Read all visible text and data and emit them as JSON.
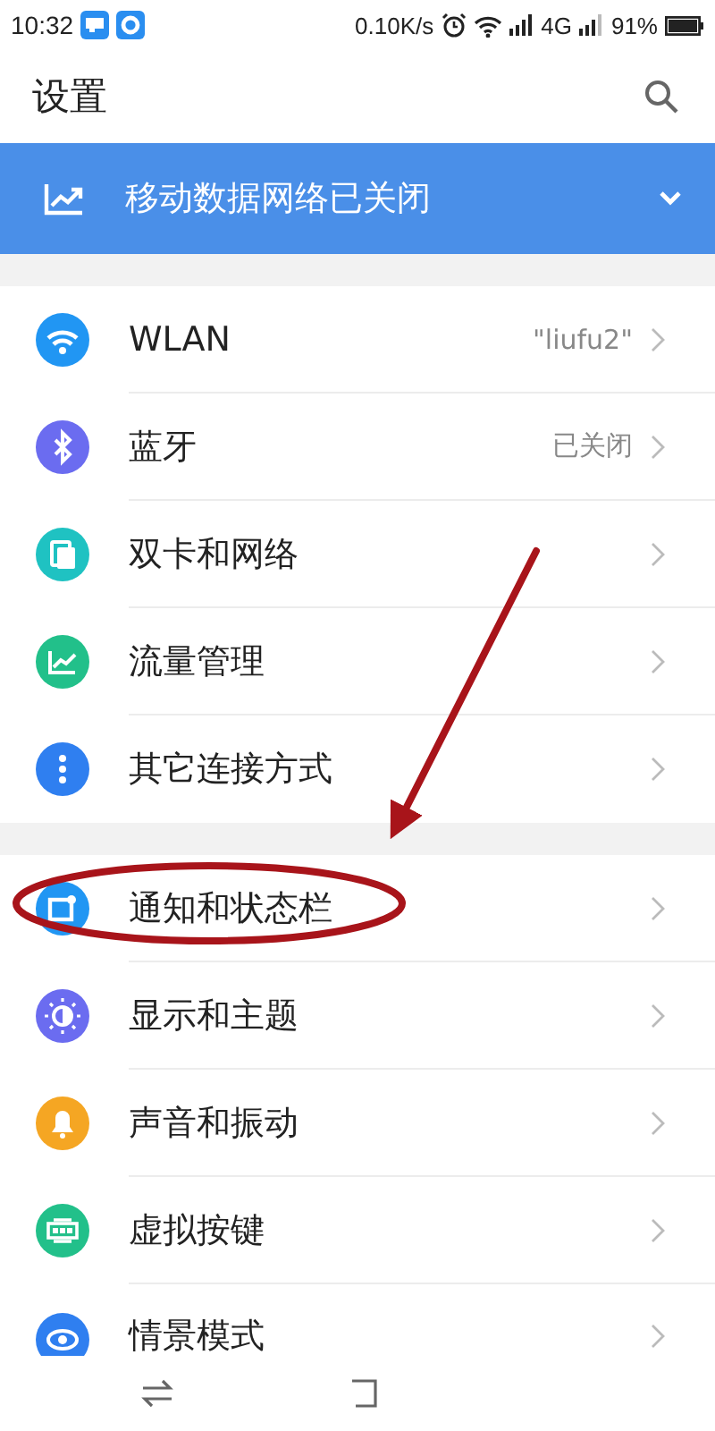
{
  "status_bar": {
    "time": "10:32",
    "speed": "0.10K/s",
    "network": "4G",
    "battery": "91%"
  },
  "header": {
    "title": "设置"
  },
  "banner": {
    "text": "移动数据网络已关闭"
  },
  "groups": [
    {
      "items": [
        {
          "label": "WLAN",
          "value": "\"liufu2\"",
          "color": "#2196f3"
        },
        {
          "label": "蓝牙",
          "value": "已关闭",
          "color": "#6b6cf0"
        },
        {
          "label": "双卡和网络",
          "color": "#1fc2c2"
        },
        {
          "label": "流量管理",
          "color": "#22c08a"
        },
        {
          "label": "其它连接方式",
          "color": "#2f7ff0"
        }
      ]
    },
    {
      "items": [
        {
          "label": "通知和状态栏",
          "color": "#2196f3"
        },
        {
          "label": "显示和主题",
          "color": "#6b6cf0"
        },
        {
          "label": "声音和振动",
          "color": "#f5a623"
        },
        {
          "label": "虚拟按键",
          "color": "#22c08a"
        },
        {
          "label": "情景模式",
          "color": "#2f7ff0"
        }
      ]
    }
  ]
}
